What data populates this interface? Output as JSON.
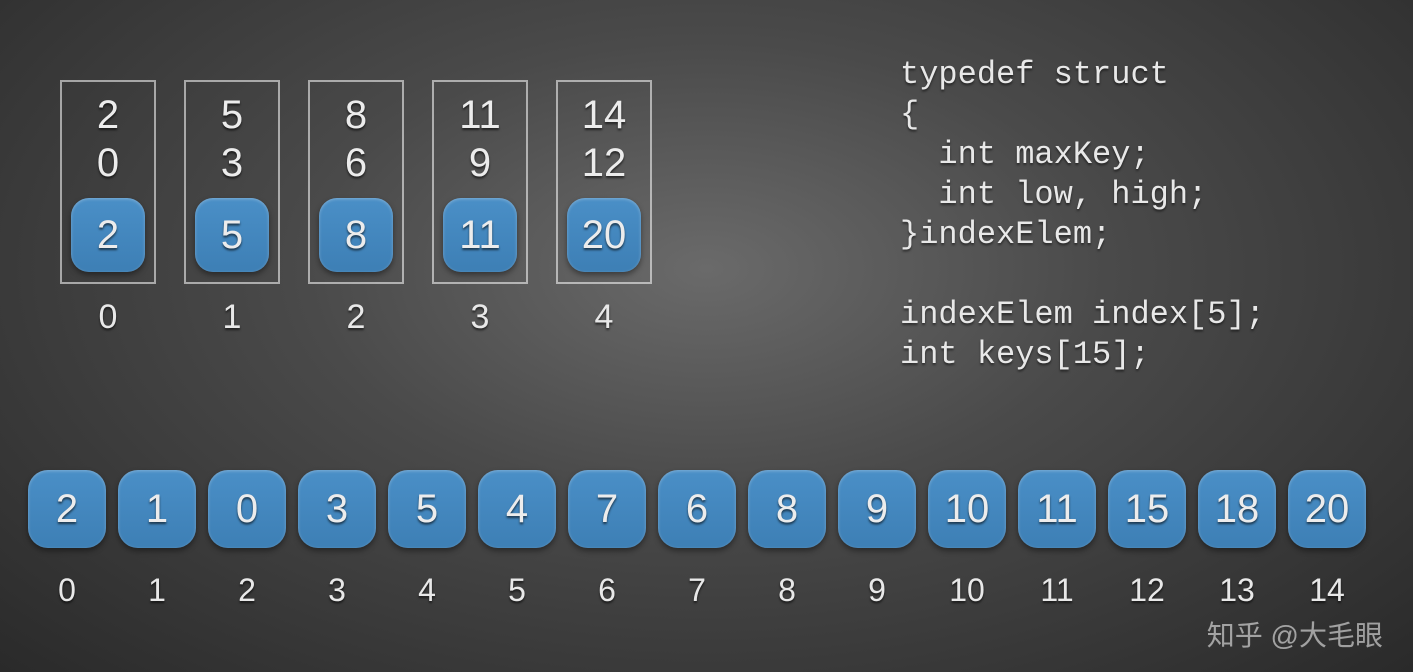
{
  "index": [
    {
      "high": "2",
      "low": "0",
      "maxKey": "2",
      "pos": "0"
    },
    {
      "high": "5",
      "low": "3",
      "maxKey": "5",
      "pos": "1"
    },
    {
      "high": "8",
      "low": "6",
      "maxKey": "8",
      "pos": "2"
    },
    {
      "high": "11",
      "low": "9",
      "maxKey": "11",
      "pos": "3"
    },
    {
      "high": "14",
      "low": "12",
      "maxKey": "20",
      "pos": "4"
    }
  ],
  "code": "typedef struct\n{\n  int maxKey;\n  int low, high;\n}indexElem;\n\nindexElem index[5];\nint keys[15];",
  "keys": [
    {
      "val": "2",
      "pos": "0"
    },
    {
      "val": "1",
      "pos": "1"
    },
    {
      "val": "0",
      "pos": "2"
    },
    {
      "val": "3",
      "pos": "3"
    },
    {
      "val": "5",
      "pos": "4"
    },
    {
      "val": "4",
      "pos": "5"
    },
    {
      "val": "7",
      "pos": "6"
    },
    {
      "val": "6",
      "pos": "7"
    },
    {
      "val": "8",
      "pos": "8"
    },
    {
      "val": "9",
      "pos": "9"
    },
    {
      "val": "10",
      "pos": "10"
    },
    {
      "val": "11",
      "pos": "11"
    },
    {
      "val": "15",
      "pos": "12"
    },
    {
      "val": "18",
      "pos": "13"
    },
    {
      "val": "20",
      "pos": "14"
    }
  ],
  "watermark": "知乎 @大毛眼",
  "chart_data": {
    "type": "table",
    "title": "indexElem / keys diagram",
    "index_array": [
      {
        "pos": 0,
        "high": 2,
        "low": 0,
        "maxKey": 2
      },
      {
        "pos": 1,
        "high": 5,
        "low": 3,
        "maxKey": 5
      },
      {
        "pos": 2,
        "high": 8,
        "low": 6,
        "maxKey": 8
      },
      {
        "pos": 3,
        "high": 11,
        "low": 9,
        "maxKey": 11
      },
      {
        "pos": 4,
        "high": 14,
        "low": 12,
        "maxKey": 20
      }
    ],
    "keys_array": [
      2,
      1,
      0,
      3,
      5,
      4,
      7,
      6,
      8,
      9,
      10,
      11,
      15,
      18,
      20
    ]
  }
}
